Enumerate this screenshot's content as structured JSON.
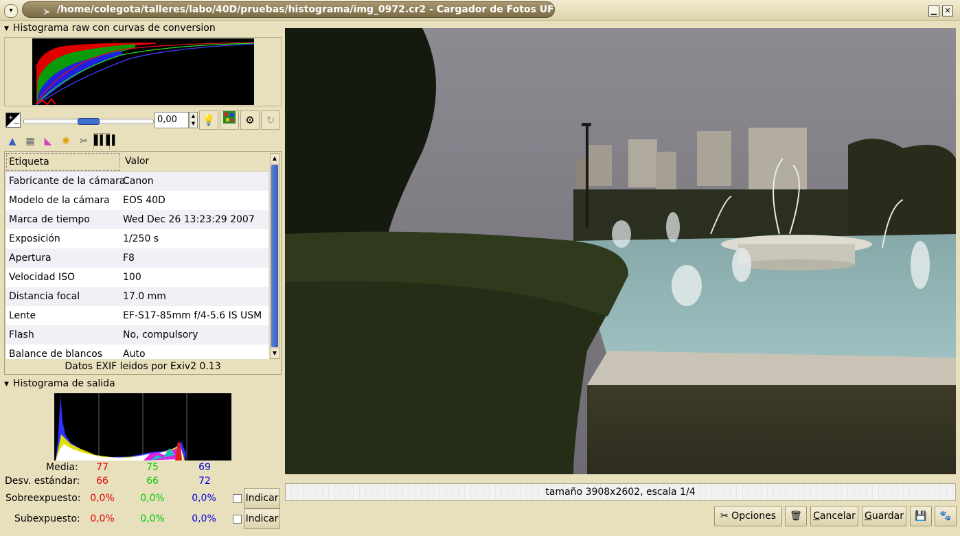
{
  "window": {
    "title": "/home/colegota/talleres/labo/40D/pruebas/histograma/img_0972.cr2 - Cargador de Fotos UFRaw"
  },
  "raw_histogram": {
    "header": "Histograma raw con curvas de conversion"
  },
  "exposure": {
    "value": "0,00",
    "slider_level": 0.5
  },
  "exif": {
    "columns": [
      "Etiqueta",
      "Valor"
    ],
    "rows": [
      [
        "Fabricante de la cámara",
        "Canon"
      ],
      [
        "Modelo de la cámara",
        "EOS 40D"
      ],
      [
        "Marca de tiempo",
        "Wed Dec 26 13:23:29 2007"
      ],
      [
        "Exposición",
        "1/250 s"
      ],
      [
        "Apertura",
        "F8"
      ],
      [
        "Velocidad ISO",
        "100"
      ],
      [
        "Distancia focal",
        "17.0 mm"
      ],
      [
        "Lente",
        "EF-S17-85mm f/4-5.6 IS USM"
      ],
      [
        "Flash",
        "No, compulsory"
      ],
      [
        "Balance de blancos",
        "Auto"
      ]
    ],
    "footer": "Datos EXIF leidos por Exiv2 0.13"
  },
  "output_histogram": {
    "header": "Histograma de salida",
    "media_label": "Media:",
    "media": [
      "77",
      "75",
      "69"
    ],
    "desv_label": "Desv. estándar:",
    "desv": [
      "66",
      "66",
      "72"
    ],
    "over_label": "Sobreexpuesto:",
    "over": [
      "0,0%",
      "0,0%",
      "0,0%"
    ],
    "under_label": "Subexpuesto:",
    "under": [
      "0,0%",
      "0,0%",
      "0,0%"
    ],
    "indicate_label": "Indicar"
  },
  "status": {
    "text": "tamaño 3908x2602, escala 1/4"
  },
  "buttons": {
    "options": "Opciones",
    "cancel_prefix": "C",
    "cancel_rest": "ancelar",
    "save_prefix": "G",
    "save_rest": "uardar"
  },
  "icons": {
    "menu": "chevron-down-icon",
    "minimize": "minimize-icon",
    "close": "close-icon"
  }
}
